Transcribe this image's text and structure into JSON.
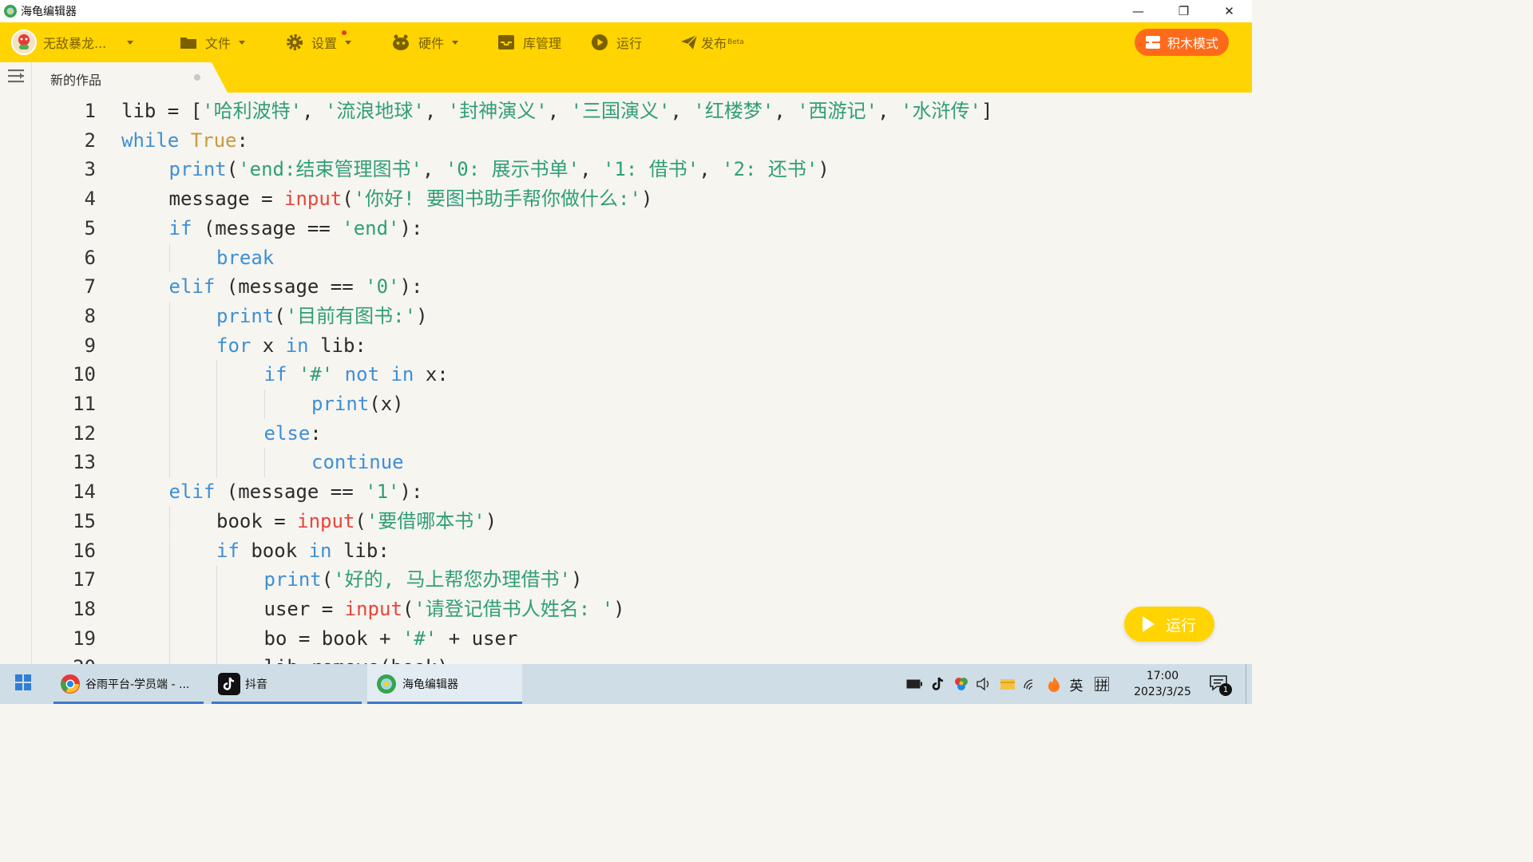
{
  "window": {
    "title": "海龟编辑器",
    "minimize_glyph": "—",
    "restore_glyph": "❐",
    "close_glyph": "✕"
  },
  "toolbar": {
    "user_name": "无敌暴龙...",
    "file_label": "文件",
    "settings_label": "设置",
    "hardware_label": "硬件",
    "library_label": "库管理",
    "run_label": "运行",
    "publish_label": "发布",
    "publish_badge": "Beta",
    "block_mode_label": "积木模式"
  },
  "tab": {
    "label": "新的作品"
  },
  "editor": {
    "lines": [
      {
        "n": "1",
        "indent": 0,
        "tokens": [
          [
            "op",
            "lib = ["
          ],
          [
            "str",
            "'哈利波特'"
          ],
          [
            "op",
            ", "
          ],
          [
            "str",
            "'流浪地球'"
          ],
          [
            "op",
            ", "
          ],
          [
            "str",
            "'封神演义'"
          ],
          [
            "op",
            ", "
          ],
          [
            "str",
            "'三国演义'"
          ],
          [
            "op",
            ", "
          ],
          [
            "str",
            "'红楼梦'"
          ],
          [
            "op",
            ", "
          ],
          [
            "str",
            "'西游记'"
          ],
          [
            "op",
            ", "
          ],
          [
            "str",
            "'水浒传'"
          ],
          [
            "op",
            "]"
          ]
        ]
      },
      {
        "n": "2",
        "indent": 0,
        "tokens": [
          [
            "kw",
            "while"
          ],
          [
            "op",
            " "
          ],
          [
            "bool",
            "True"
          ],
          [
            "op",
            ":"
          ]
        ]
      },
      {
        "n": "3",
        "indent": 1,
        "tokens": [
          [
            "fn",
            "print"
          ],
          [
            "op",
            "("
          ],
          [
            "str",
            "'end:结束管理图书'"
          ],
          [
            "op",
            ", "
          ],
          [
            "str",
            "'0: 展示书单'"
          ],
          [
            "op",
            ", "
          ],
          [
            "str",
            "'1: 借书'"
          ],
          [
            "op",
            ", "
          ],
          [
            "str",
            "'2: 还书'"
          ],
          [
            "op",
            ")"
          ]
        ]
      },
      {
        "n": "4",
        "indent": 1,
        "tokens": [
          [
            "op",
            "message = "
          ],
          [
            "in",
            "input"
          ],
          [
            "op",
            "("
          ],
          [
            "str",
            "'你好! 要图书助手帮你做什么:'"
          ],
          [
            "op",
            ")"
          ]
        ]
      },
      {
        "n": "5",
        "indent": 1,
        "tokens": [
          [
            "kw",
            "if"
          ],
          [
            "op",
            " (message == "
          ],
          [
            "str",
            "'end'"
          ],
          [
            "op",
            "):"
          ]
        ]
      },
      {
        "n": "6",
        "indent": 2,
        "tokens": [
          [
            "kw",
            "break"
          ]
        ]
      },
      {
        "n": "7",
        "indent": 1,
        "tokens": [
          [
            "kw",
            "elif"
          ],
          [
            "op",
            " (message == "
          ],
          [
            "str",
            "'0'"
          ],
          [
            "op",
            "):"
          ]
        ]
      },
      {
        "n": "8",
        "indent": 2,
        "tokens": [
          [
            "fn",
            "print"
          ],
          [
            "op",
            "("
          ],
          [
            "str",
            "'目前有图书:'"
          ],
          [
            "op",
            ")"
          ]
        ]
      },
      {
        "n": "9",
        "indent": 2,
        "tokens": [
          [
            "kw",
            "for"
          ],
          [
            "op",
            " x "
          ],
          [
            "kw",
            "in"
          ],
          [
            "op",
            " lib:"
          ]
        ]
      },
      {
        "n": "10",
        "indent": 3,
        "tokens": [
          [
            "kw",
            "if"
          ],
          [
            "op",
            " "
          ],
          [
            "str",
            "'#'"
          ],
          [
            "op",
            " "
          ],
          [
            "kw",
            "not in"
          ],
          [
            "op",
            " x:"
          ]
        ]
      },
      {
        "n": "11",
        "indent": 4,
        "tokens": [
          [
            "fn",
            "print"
          ],
          [
            "op",
            "(x)"
          ]
        ]
      },
      {
        "n": "12",
        "indent": 3,
        "tokens": [
          [
            "kw",
            "else"
          ],
          [
            "op",
            ":"
          ]
        ]
      },
      {
        "n": "13",
        "indent": 4,
        "tokens": [
          [
            "kw",
            "continue"
          ]
        ]
      },
      {
        "n": "14",
        "indent": 1,
        "tokens": [
          [
            "kw",
            "elif"
          ],
          [
            "op",
            " (message == "
          ],
          [
            "str",
            "'1'"
          ],
          [
            "op",
            "):"
          ]
        ]
      },
      {
        "n": "15",
        "indent": 2,
        "tokens": [
          [
            "op",
            "book = "
          ],
          [
            "in",
            "input"
          ],
          [
            "op",
            "("
          ],
          [
            "str",
            "'要借哪本书'"
          ],
          [
            "op",
            ")"
          ]
        ]
      },
      {
        "n": "16",
        "indent": 2,
        "tokens": [
          [
            "kw",
            "if"
          ],
          [
            "op",
            " book "
          ],
          [
            "kw",
            "in"
          ],
          [
            "op",
            " lib:"
          ]
        ]
      },
      {
        "n": "17",
        "indent": 3,
        "tokens": [
          [
            "fn",
            "print"
          ],
          [
            "op",
            "("
          ],
          [
            "str",
            "'好的, 马上帮您办理借书'"
          ],
          [
            "op",
            ")"
          ]
        ]
      },
      {
        "n": "18",
        "indent": 3,
        "tokens": [
          [
            "op",
            "user = "
          ],
          [
            "in",
            "input"
          ],
          [
            "op",
            "("
          ],
          [
            "str",
            "'请登记借书人姓名: '"
          ],
          [
            "op",
            ")"
          ]
        ]
      },
      {
        "n": "19",
        "indent": 3,
        "tokens": [
          [
            "op",
            "bo = book + "
          ],
          [
            "str",
            "'#'"
          ],
          [
            "op",
            " + user"
          ]
        ]
      },
      {
        "n": "20",
        "indent": 3,
        "tokens": [
          [
            "op",
            "lib.remove(book)"
          ]
        ]
      }
    ],
    "run_button_label": "运行"
  },
  "taskbar": {
    "items": [
      {
        "label": "谷雨平台-学员端 - ..."
      },
      {
        "label": "抖音"
      },
      {
        "label": "海龟编辑器"
      }
    ],
    "ime_lang": "英",
    "ime_mode": "拼",
    "time": "17:00",
    "date": "2023/3/25",
    "notification_count": "1"
  },
  "colors": {
    "toolbar_bg": "#ffd400",
    "accent_orange": "#ff6a1a",
    "keyword": "#3e8fd6",
    "string": "#2f9e79",
    "builtin_input": "#e8453c",
    "bool": "#c79a3a"
  }
}
